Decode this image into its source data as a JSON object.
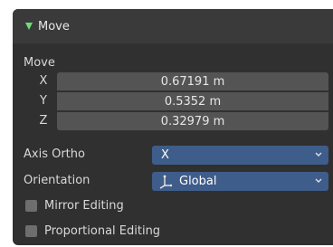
{
  "panel": {
    "title": "Move",
    "section_label": "Move",
    "fields": [
      {
        "axis": "X",
        "value": "0.67191 m"
      },
      {
        "axis": "Y",
        "value": "0.5352 m"
      },
      {
        "axis": "Z",
        "value": "0.32979 m"
      }
    ],
    "axis_ortho": {
      "label": "Axis Ortho",
      "value": "X"
    },
    "orientation": {
      "label": "Orientation",
      "value": "Global"
    },
    "mirror_editing": {
      "label": "Mirror Editing",
      "checked": false
    },
    "proportional_editing": {
      "label": "Proportional Editing",
      "checked": false
    }
  },
  "colors": {
    "panel_bg": "#303030",
    "header_bg": "#3a3a3a",
    "field_bg": "#545454",
    "dropdown_bg": "#3f5d8a",
    "accent_green": "#6fdc7c"
  },
  "icons": {
    "collapse": "triangle-down-icon",
    "dropdown": "chevron-down-icon",
    "orientation": "transform-axes-icon"
  }
}
